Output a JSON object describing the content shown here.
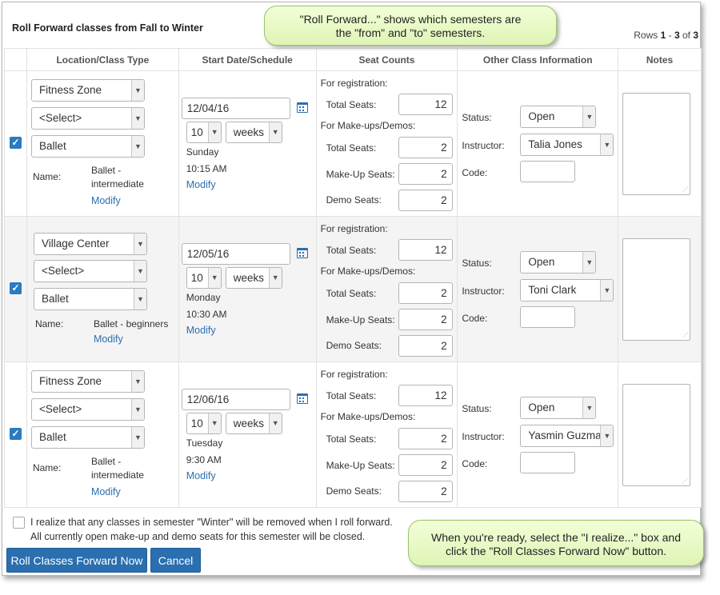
{
  "page_title": "Roll Forward classes from Fall to Winter",
  "rows_info": {
    "prefix": "Rows ",
    "start": "1",
    "sep": " - ",
    "end": "3",
    "of": " of ",
    "total": "3"
  },
  "columns": [
    "Location/Class Type",
    "Start Date/Schedule",
    "Seat Counts",
    "Other Class Information",
    "Notes"
  ],
  "labels": {
    "name": "Name:",
    "modify": "Modify",
    "for_registration": "For registration:",
    "total_seats": "Total Seats:",
    "makeups_demos": "For Make-ups/Demos:",
    "makeup_seats": "Make-Up Seats:",
    "demo_seats": "Demo Seats:",
    "status": "Status:",
    "instructor": "Instructor:",
    "code": "Code:"
  },
  "rows": [
    {
      "location": "Fitness Zone",
      "category": "<Select>",
      "class_type": "Ballet",
      "name_line1": "Ballet -",
      "name_line2": "intermediate",
      "date": "12/04/16",
      "count": "10",
      "unit": "weeks",
      "day": "Sunday",
      "time": "10:15 AM",
      "reg_total": "12",
      "mk_total": "2",
      "makeup": "2",
      "demo": "2",
      "status": "Open",
      "instructor": "Talia Jones",
      "code": "",
      "checked": true
    },
    {
      "location": "Village Center",
      "category": "<Select>",
      "class_type": "Ballet",
      "name_line1": "Ballet - beginners",
      "name_line2": "",
      "date": "12/05/16",
      "count": "10",
      "unit": "weeks",
      "day": "Monday",
      "time": "10:30 AM",
      "reg_total": "12",
      "mk_total": "2",
      "makeup": "2",
      "demo": "2",
      "status": "Open",
      "instructor": "Toni Clark",
      "code": "",
      "checked": true
    },
    {
      "location": "Fitness Zone",
      "category": "<Select>",
      "class_type": "Ballet",
      "name_line1": "Ballet -",
      "name_line2": "intermediate",
      "date": "12/06/16",
      "count": "10",
      "unit": "weeks",
      "day": "Tuesday",
      "time": "9:30 AM",
      "reg_total": "12",
      "mk_total": "2",
      "makeup": "2",
      "demo": "2",
      "status": "Open",
      "instructor": "Yasmin Guzma",
      "code": "",
      "checked": true
    }
  ],
  "footer": {
    "agree_line1": "I realize that any classes in semester \"Winter\" will be removed when I roll forward.",
    "agree_line2": "All currently open make-up and demo seats for this semester will be closed.",
    "roll_button": "Roll Classes Forward Now",
    "cancel_button": "Cancel"
  },
  "callouts": {
    "top_line1": "\"Roll Forward...\" shows which semesters are",
    "top_line2": "the \"from\" and \"to\" semesters.",
    "bottom_line1": "When you're ready, select the \"I realize...\" box and",
    "bottom_line2": "click the \"Roll Classes Forward Now\" button."
  },
  "colors": {
    "accent": "#2a6fb0",
    "callout": "#e6f7c4"
  },
  "icons": {
    "calendar": "calendar-icon",
    "checkbox": "checkbox-icon",
    "dropdown": "chevron-down-icon"
  }
}
